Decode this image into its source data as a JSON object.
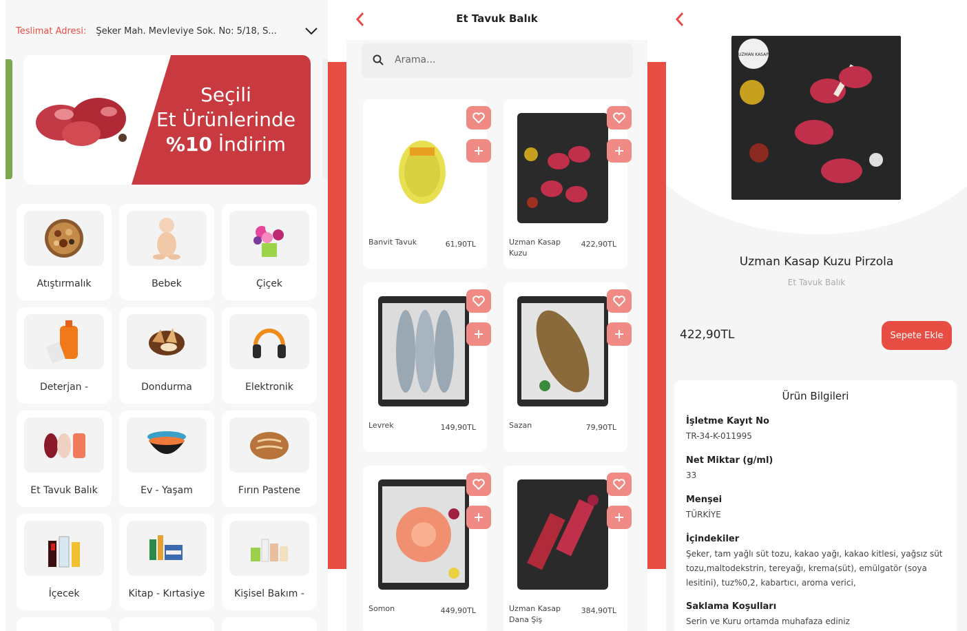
{
  "screen1": {
    "address_label": "Teslimat Adresi:",
    "address_value": "Şeker Mah. Mevleviye Sok. No: 5/18, S...",
    "banner_lines": [
      "Seçili",
      "Et Ürünlerinde"
    ],
    "banner_discount": "%10",
    "banner_discount_rest": " İndirim",
    "categories": [
      {
        "label": "Atıştırmalık",
        "icon": "nuts-icon"
      },
      {
        "label": "Bebek",
        "icon": "baby-icon"
      },
      {
        "label": "Çiçek",
        "icon": "flower-icon"
      },
      {
        "label": "Deterjan -",
        "icon": "detergent-icon"
      },
      {
        "label": "Dondurma",
        "icon": "ice-cream-icon"
      },
      {
        "label": "Elektronik",
        "icon": "headphones-icon"
      },
      {
        "label": "Et Tavuk Balık",
        "icon": "meat-icon"
      },
      {
        "label": "Ev - Yaşam",
        "icon": "bowls-icon"
      },
      {
        "label": "Fırın Pastene",
        "icon": "bread-icon"
      },
      {
        "label": "İçecek",
        "icon": "drinks-icon"
      },
      {
        "label": "Kitap - Kırtasiye",
        "icon": "stationery-icon"
      },
      {
        "label": "Kişisel Bakım -",
        "icon": "personal-care-icon"
      }
    ]
  },
  "screen2": {
    "title": "Et Tavuk Balık",
    "search_placeholder": "Arama...",
    "products": [
      {
        "name": "Banvit Tavuk",
        "price": "61,90TL",
        "image": "chicken-pack"
      },
      {
        "name": "Uzman Kasap Kuzu",
        "price": "422,90TL",
        "image": "lamb-chops"
      },
      {
        "name": "Levrek",
        "price": "149,90TL",
        "image": "sea-bass"
      },
      {
        "name": "Sazan",
        "price": "79,90TL",
        "image": "carp"
      },
      {
        "name": "Somon",
        "price": "449,90TL",
        "image": "salmon"
      },
      {
        "name": "Uzman Kasap Dana Şiş",
        "price": "384,90TL",
        "image": "beef-skewers"
      }
    ]
  },
  "screen3": {
    "product_name": "Uzman Kasap Kuzu Pirzola",
    "category": "Et Tavuk Balık",
    "price": "422,90TL",
    "add_button": "Sepete Ekle",
    "info_title": "Ürün Bilgileri",
    "logo_text": "UZMAN KASAP",
    "fields": [
      {
        "key": "İşletme Kayıt No",
        "value": "TR-34-K-011995"
      },
      {
        "key": "Net Miktar (g/ml)",
        "value": "33"
      },
      {
        "key": "Menşei",
        "value": "TÜRKİYE"
      },
      {
        "key": "İçindekiler",
        "value": "Şeker, tam yağlı süt tozu, kakao yağı, kakao kitlesi, yağsız süt tozu,maltodekstrin, tereyağı, krema(süt), emülgatör (soya lesitini), tuz%0,2, kabartıcı, aroma verici,"
      },
      {
        "key": "Saklama Koşulları",
        "value": "Serin ve Kuru ortamda muhafaza ediniz"
      }
    ]
  },
  "colors": {
    "accent": "#e84d43",
    "banner_red": "#c83a3f",
    "heart_bg": "#f08a84"
  }
}
